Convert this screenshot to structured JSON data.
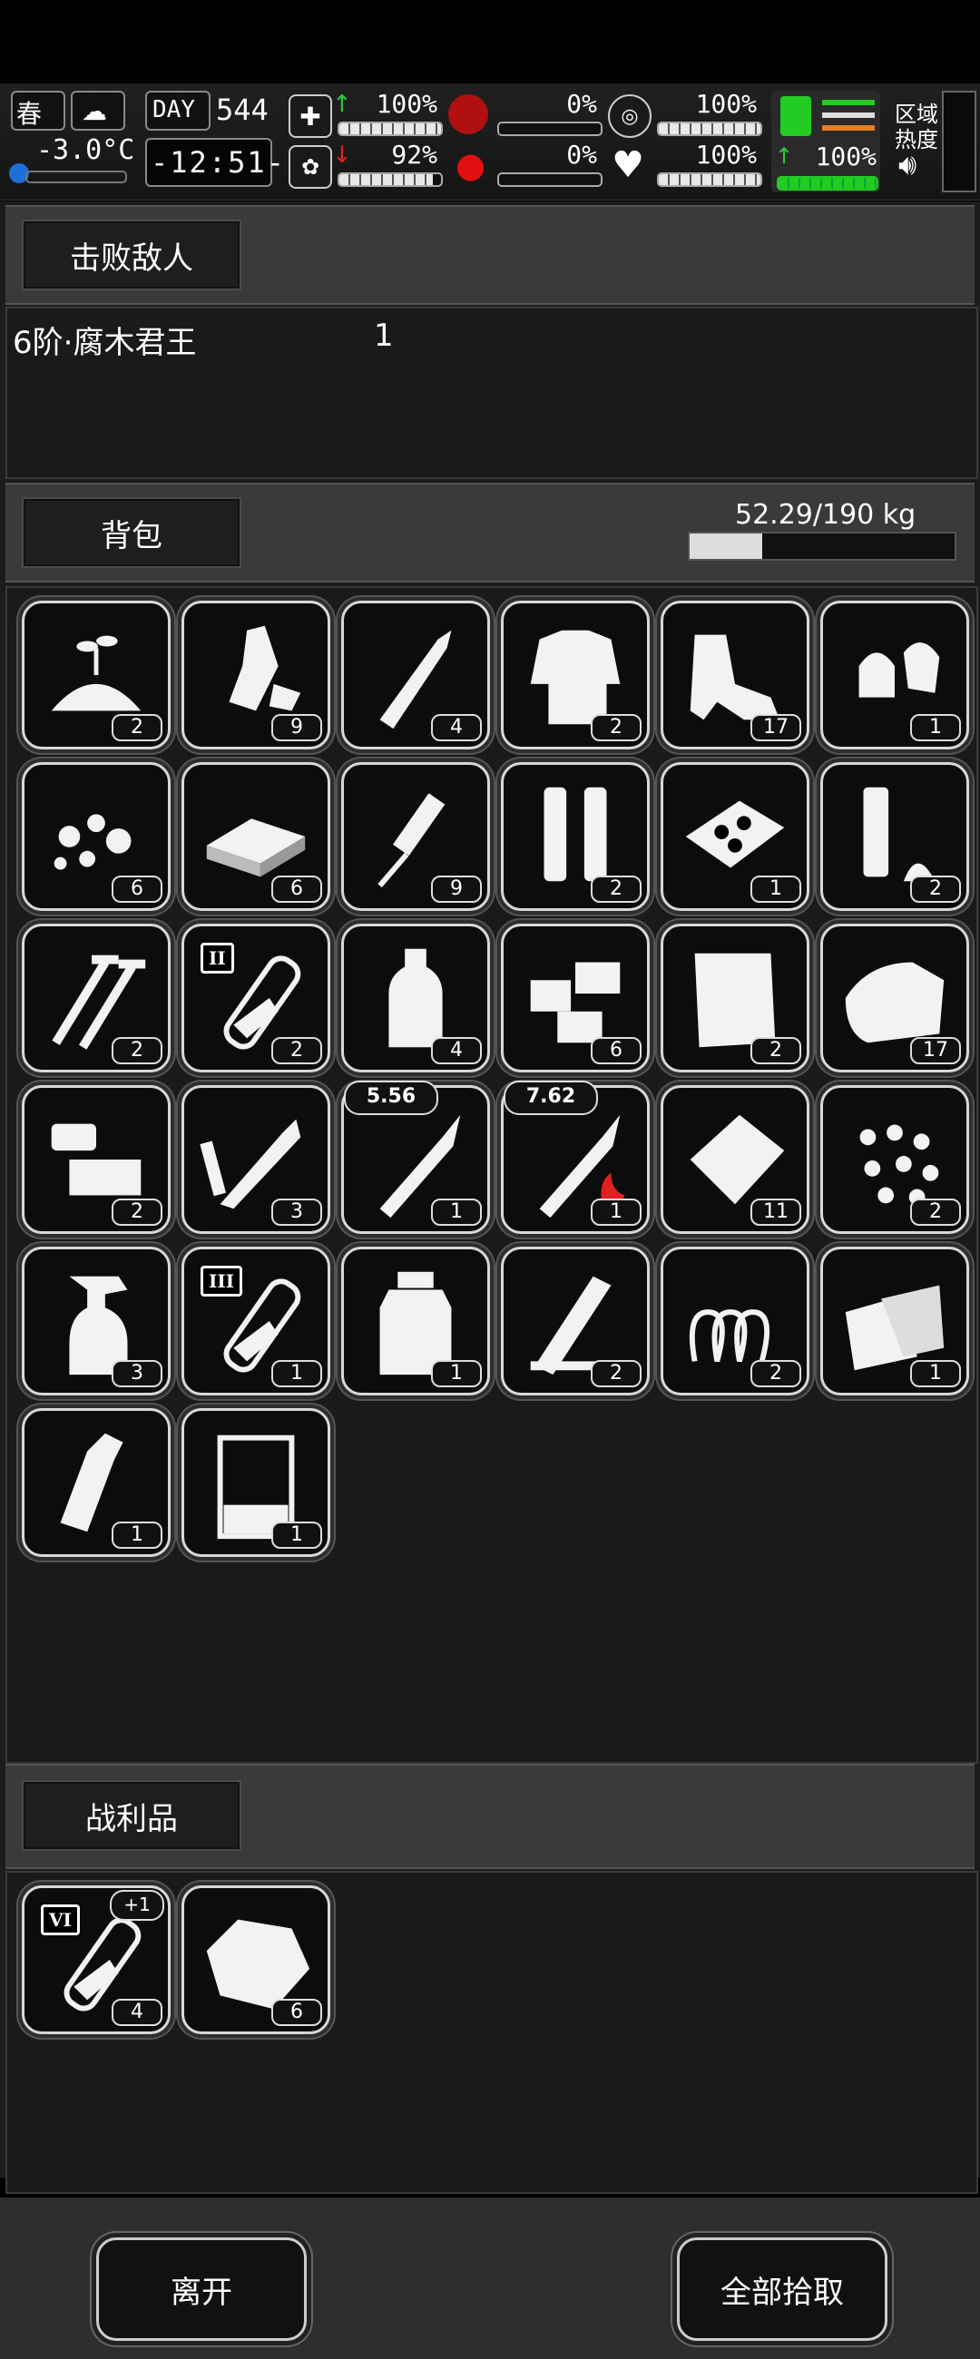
{
  "hud": {
    "season": "春",
    "temperature": "-3.0°C",
    "day_label": "DAY",
    "day_number": "544",
    "clock": "-12:51-",
    "stats": [
      {
        "name": "health",
        "value": "100%",
        "level": 1.0,
        "trend": "up"
      },
      {
        "name": "hunger",
        "value": "0%",
        "level": 0.0
      },
      {
        "name": "armor",
        "value": "100%",
        "level": 1.0
      },
      {
        "name": "mental",
        "value": "92%",
        "level": 0.92,
        "trend": "down"
      },
      {
        "name": "bleeding",
        "value": "0%",
        "level": 0.0
      },
      {
        "name": "heart",
        "value": "100%",
        "level": 1.0
      }
    ],
    "stamina": {
      "value": "100%",
      "level": 1.0,
      "trend": "up"
    },
    "zone_heat_label_1": "区域",
    "zone_heat_label_2": "热度"
  },
  "defeat": {
    "tab_label": "击败敌人",
    "enemy_name": "6阶·腐木君王",
    "enemy_count": "1"
  },
  "backpack": {
    "tab_label": "背包",
    "weight": "52.29/190 kg",
    "weight_fraction": 0.275,
    "items": [
      {
        "icon": "seedling-soil-icon",
        "count": "2"
      },
      {
        "icon": "crushed-bottle-icon",
        "count": "9"
      },
      {
        "icon": "bullet-tip-icon",
        "count": "4"
      },
      {
        "icon": "torn-shirt-icon",
        "count": "2"
      },
      {
        "icon": "torn-pants-icon",
        "count": "17"
      },
      {
        "icon": "bullet-heads-icon",
        "count": "1"
      },
      {
        "icon": "rubble-icon",
        "count": "6"
      },
      {
        "icon": "brick-icon",
        "count": "6"
      },
      {
        "icon": "syringe-tool-icon",
        "count": "9"
      },
      {
        "icon": "shell-casings-icon",
        "count": "2"
      },
      {
        "icon": "cracker-tray-icon",
        "count": "1"
      },
      {
        "icon": "casing-and-cap-icon",
        "count": "2"
      },
      {
        "icon": "screws-icon",
        "count": "2"
      },
      {
        "icon": "test-tube-2-icon",
        "count": "2",
        "tier": "II"
      },
      {
        "icon": "water-bottle-icon",
        "count": "4"
      },
      {
        "icon": "wood-blocks-icon",
        "count": "6"
      },
      {
        "icon": "cloth-icon",
        "count": "2"
      },
      {
        "icon": "folded-cloth-icon",
        "count": "17"
      },
      {
        "icon": "machine-parts-icon",
        "count": "2"
      },
      {
        "icon": "soldering-pen-icon",
        "count": "3"
      },
      {
        "icon": "rifle-round-icon",
        "count": "1",
        "caliber": "5.56"
      },
      {
        "icon": "incendiary-round-icon",
        "count": "1",
        "caliber": "7.62"
      },
      {
        "icon": "sachet-icon",
        "count": "11"
      },
      {
        "icon": "pellets-icon",
        "count": "2"
      },
      {
        "icon": "spray-bottle-icon",
        "count": "3"
      },
      {
        "icon": "test-tube-3-icon",
        "count": "1",
        "tier": "III"
      },
      {
        "icon": "medicine-jar-icon",
        "count": "1"
      },
      {
        "icon": "wood-planks-icon",
        "count": "2"
      },
      {
        "icon": "spring-icon",
        "count": "2"
      },
      {
        "icon": "paper-sheets-icon",
        "count": "1"
      },
      {
        "icon": "glass-bottle-icon",
        "count": "1"
      },
      {
        "icon": "beaker-icon",
        "count": "1"
      }
    ]
  },
  "loot": {
    "tab_label": "战利品",
    "items": [
      {
        "icon": "test-tube-6-icon",
        "count": "4",
        "tier": "VI",
        "bonus": "+1"
      },
      {
        "icon": "ore-chunk-icon",
        "count": "6"
      }
    ]
  },
  "buttons": {
    "leave": "离开",
    "pick_all": "全部拾取"
  }
}
